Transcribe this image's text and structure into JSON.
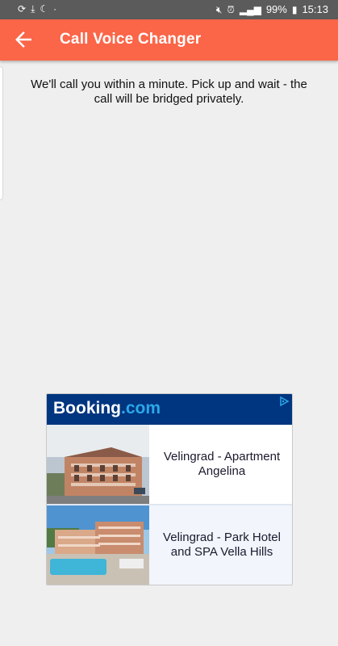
{
  "status_bar": {
    "battery": "99%",
    "time": "15:13"
  },
  "app_bar": {
    "title": "Call Voice Changer",
    "back_icon": "arrow-back-icon"
  },
  "message": "We'll call you within a minute. Pick up and wait - the call will be bridged privately.",
  "ad": {
    "brand_main": "Booking",
    "brand_dot": ".com",
    "adchoices_icon": "adchoices-icon",
    "listings": [
      {
        "name": "Velingrad - Apartment Angelina"
      },
      {
        "name": "Velingrad - Park Hotel and SPA Vella Hills"
      }
    ]
  },
  "colors": {
    "app_bar": "#fb6548",
    "status_bar": "#5b5b5b",
    "background": "#efefef",
    "booking_blue": "#003580",
    "booking_dot": "#2ca8e8"
  }
}
